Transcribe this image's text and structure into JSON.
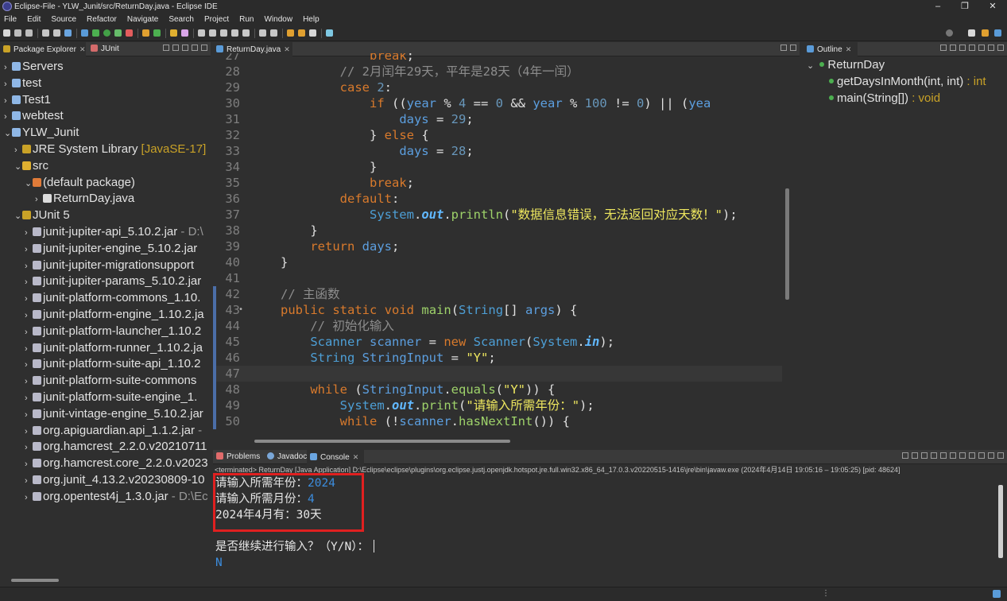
{
  "window": {
    "title": "Eclipse-File - YLW_Junit/src/ReturnDay.java - Eclipse IDE",
    "controls": [
      "–",
      "❐",
      "✕"
    ]
  },
  "menu": [
    "File",
    "Edit",
    "Source",
    "Refactor",
    "Navigate",
    "Search",
    "Project",
    "Run",
    "Window",
    "Help"
  ],
  "package_explorer": {
    "tabs": [
      "Package Explorer",
      "JUnit"
    ],
    "items": [
      {
        "label": "Servers",
        "arrow": "›",
        "icon": "project-icon",
        "indent": 0
      },
      {
        "label": "test",
        "arrow": "›",
        "icon": "project-icon",
        "indent": 0
      },
      {
        "label": "Test1",
        "arrow": "›",
        "icon": "project-icon",
        "indent": 0
      },
      {
        "label": "webtest",
        "arrow": "›",
        "icon": "project-icon",
        "indent": 0
      },
      {
        "label": "YLW_Junit",
        "arrow": "⌄",
        "icon": "project-icon",
        "indent": 0
      },
      {
        "label": "JRE System Library",
        "decoration": "[JavaSE-17]",
        "arrow": "›",
        "icon": "library-icon",
        "indent": 1
      },
      {
        "label": "src",
        "arrow": "⌄",
        "icon": "source-folder-icon",
        "indent": 1
      },
      {
        "label": "(default package)",
        "arrow": "⌄",
        "icon": "package-icon",
        "indent": 2
      },
      {
        "label": "ReturnDay.java",
        "arrow": "›",
        "icon": "java-file-icon",
        "indent": 3
      },
      {
        "label": "JUnit 5",
        "arrow": "⌄",
        "icon": "library-icon",
        "indent": 1
      },
      {
        "label": "junit-jupiter-api_5.10.2.jar",
        "decoration": " - D:\\",
        "arrow": "›",
        "icon": "jar-icon",
        "indent": 2
      },
      {
        "label": "junit-jupiter-engine_5.10.2.jar",
        "arrow": "›",
        "icon": "jar-icon",
        "indent": 2
      },
      {
        "label": "junit-jupiter-migrationsupport",
        "arrow": "›",
        "icon": "jar-icon",
        "indent": 2
      },
      {
        "label": "junit-jupiter-params_5.10.2.jar",
        "arrow": "›",
        "icon": "jar-icon",
        "indent": 2
      },
      {
        "label": "junit-platform-commons_1.10.",
        "arrow": "›",
        "icon": "jar-icon",
        "indent": 2
      },
      {
        "label": "junit-platform-engine_1.10.2.ja",
        "arrow": "›",
        "icon": "jar-icon",
        "indent": 2
      },
      {
        "label": "junit-platform-launcher_1.10.2",
        "arrow": "›",
        "icon": "jar-icon",
        "indent": 2
      },
      {
        "label": "junit-platform-runner_1.10.2.ja",
        "arrow": "›",
        "icon": "jar-icon",
        "indent": 2
      },
      {
        "label": "junit-platform-suite-api_1.10.2",
        "arrow": "›",
        "icon": "jar-icon",
        "indent": 2
      },
      {
        "label": "junit-platform-suite-commons",
        "arrow": "›",
        "icon": "jar-icon",
        "indent": 2
      },
      {
        "label": "junit-platform-suite-engine_1.",
        "arrow": "›",
        "icon": "jar-icon",
        "indent": 2
      },
      {
        "label": "junit-vintage-engine_5.10.2.jar",
        "arrow": "›",
        "icon": "jar-icon",
        "indent": 2
      },
      {
        "label": "org.apiguardian.api_1.1.2.jar",
        "decoration": " -",
        "arrow": "›",
        "icon": "jar-icon",
        "indent": 2
      },
      {
        "label": "org.hamcrest_2.2.0.v20210711",
        "arrow": "›",
        "icon": "jar-icon",
        "indent": 2
      },
      {
        "label": "org.hamcrest.core_2.2.0.v2023",
        "arrow": "›",
        "icon": "jar-icon",
        "indent": 2
      },
      {
        "label": "org.junit_4.13.2.v20230809-10",
        "arrow": "›",
        "icon": "jar-icon",
        "indent": 2
      },
      {
        "label": "org.opentest4j_1.3.0.jar",
        "decoration": " - D:\\Ec",
        "arrow": "›",
        "icon": "jar-icon",
        "indent": 2
      }
    ]
  },
  "editor": {
    "tab": "ReturnDay.java",
    "current_line": 47,
    "lines": [
      {
        "n": "27",
        "t": [
          [
            "            ",
            "p"
          ],
          [
            "break",
            "k"
          ],
          [
            ";",
            "p"
          ]
        ]
      },
      {
        "n": "28",
        "t": [
          [
            "        ",
            "p"
          ],
          [
            "// 2月闰年29天，平年是28天（4年一闰）",
            "c"
          ]
        ]
      },
      {
        "n": "29",
        "t": [
          [
            "        ",
            "p"
          ],
          [
            "case",
            "k"
          ],
          [
            " ",
            "p"
          ],
          [
            "2",
            "n"
          ],
          [
            ":",
            "p"
          ]
        ]
      },
      {
        "n": "30",
        "t": [
          [
            "            ",
            "p"
          ],
          [
            "if",
            "k"
          ],
          [
            " ((",
            "p"
          ],
          [
            "year",
            "v"
          ],
          [
            " % ",
            "p"
          ],
          [
            "4",
            "n"
          ],
          [
            " == ",
            "p"
          ],
          [
            "0",
            "n"
          ],
          [
            " && ",
            "p"
          ],
          [
            "year",
            "v"
          ],
          [
            " % ",
            "p"
          ],
          [
            "100",
            "n"
          ],
          [
            " != ",
            "p"
          ],
          [
            "0",
            "n"
          ],
          [
            ") || (",
            "p"
          ],
          [
            "yea",
            "v"
          ]
        ]
      },
      {
        "n": "31",
        "t": [
          [
            "                ",
            "p"
          ],
          [
            "days",
            "v"
          ],
          [
            " = ",
            "p"
          ],
          [
            "29",
            "n"
          ],
          [
            ";",
            "p"
          ]
        ]
      },
      {
        "n": "32",
        "t": [
          [
            "            } ",
            "p"
          ],
          [
            "else",
            "k"
          ],
          [
            " {",
            "p"
          ]
        ]
      },
      {
        "n": "33",
        "t": [
          [
            "                ",
            "p"
          ],
          [
            "days",
            "v"
          ],
          [
            " = ",
            "p"
          ],
          [
            "28",
            "n"
          ],
          [
            ";",
            "p"
          ]
        ]
      },
      {
        "n": "34",
        "t": [
          [
            "            }",
            "p"
          ]
        ]
      },
      {
        "n": "35",
        "t": [
          [
            "            ",
            "p"
          ],
          [
            "break",
            "k"
          ],
          [
            ";",
            "p"
          ]
        ]
      },
      {
        "n": "36",
        "t": [
          [
            "        ",
            "p"
          ],
          [
            "default",
            "k"
          ],
          [
            ":",
            "p"
          ]
        ]
      },
      {
        "n": "37",
        "t": [
          [
            "            ",
            "p"
          ],
          [
            "System",
            "t"
          ],
          [
            ".",
            "p"
          ],
          [
            "out",
            "st"
          ],
          [
            ".",
            "p"
          ],
          [
            "println",
            "m"
          ],
          [
            "(",
            "p"
          ],
          [
            "\"数据信息错误，无法返回对应天数！\"",
            "s"
          ],
          [
            ");",
            "p"
          ]
        ]
      },
      {
        "n": "38",
        "t": [
          [
            "    }",
            "p"
          ]
        ]
      },
      {
        "n": "39",
        "t": [
          [
            "    ",
            "p"
          ],
          [
            "return",
            "k"
          ],
          [
            " ",
            "p"
          ],
          [
            "days",
            "v"
          ],
          [
            ";",
            "p"
          ]
        ]
      },
      {
        "n": "40",
        "t": [
          [
            "}",
            "p"
          ]
        ]
      },
      {
        "n": "41",
        "t": [
          [
            "",
            "p"
          ]
        ]
      },
      {
        "n": "42",
        "t": [
          [
            "// 主函数",
            "c"
          ]
        ]
      },
      {
        "n": "43",
        "mark": "•",
        "t": [
          [
            "public",
            "k"
          ],
          [
            " ",
            "p"
          ],
          [
            "static",
            "k"
          ],
          [
            " ",
            "p"
          ],
          [
            "void",
            "k"
          ],
          [
            " ",
            "p"
          ],
          [
            "main",
            "m"
          ],
          [
            "(",
            "p"
          ],
          [
            "String",
            "t"
          ],
          [
            "[] ",
            "p"
          ],
          [
            "args",
            "v"
          ],
          [
            ") {",
            "p"
          ]
        ]
      },
      {
        "n": "44",
        "t": [
          [
            "    ",
            "p"
          ],
          [
            "// 初始化输入",
            "c"
          ]
        ]
      },
      {
        "n": "45",
        "t": [
          [
            "    ",
            "p"
          ],
          [
            "Scanner",
            "t"
          ],
          [
            " ",
            "p"
          ],
          [
            "scanner",
            "v"
          ],
          [
            " = ",
            "p"
          ],
          [
            "new",
            "k"
          ],
          [
            " ",
            "p"
          ],
          [
            "Scanner",
            "t"
          ],
          [
            "(",
            "p"
          ],
          [
            "System",
            "t"
          ],
          [
            ".",
            "p"
          ],
          [
            "in",
            "st"
          ],
          [
            ");",
            "p"
          ]
        ]
      },
      {
        "n": "46",
        "t": [
          [
            "    ",
            "p"
          ],
          [
            "String",
            "t"
          ],
          [
            " ",
            "p"
          ],
          [
            "StringInput",
            "v"
          ],
          [
            " = ",
            "p"
          ],
          [
            "\"Y\"",
            "s"
          ],
          [
            ";",
            "p"
          ]
        ]
      },
      {
        "n": "47",
        "t": [
          [
            "",
            "p"
          ]
        ]
      },
      {
        "n": "48",
        "t": [
          [
            "    ",
            "p"
          ],
          [
            "while",
            "k"
          ],
          [
            " (",
            "p"
          ],
          [
            "StringInput",
            "v"
          ],
          [
            ".",
            "p"
          ],
          [
            "equals",
            "m"
          ],
          [
            "(",
            "p"
          ],
          [
            "\"Y\"",
            "s"
          ],
          [
            ")) {",
            "p"
          ]
        ]
      },
      {
        "n": "49",
        "t": [
          [
            "        ",
            "p"
          ],
          [
            "System",
            "t"
          ],
          [
            ".",
            "p"
          ],
          [
            "out",
            "st"
          ],
          [
            ".",
            "p"
          ],
          [
            "print",
            "m"
          ],
          [
            "(",
            "p"
          ],
          [
            "\"请输入所需年份：\"",
            "s"
          ],
          [
            ");",
            "p"
          ]
        ]
      },
      {
        "n": "50",
        "t": [
          [
            "        ",
            "p"
          ],
          [
            "while",
            "k"
          ],
          [
            " (!",
            "p"
          ],
          [
            "scanner",
            "v"
          ],
          [
            ".",
            "p"
          ],
          [
            "hasNextInt",
            "m"
          ],
          [
            "()) {",
            "p"
          ]
        ]
      }
    ]
  },
  "outline": {
    "tab": "Outline",
    "class_name": "ReturnDay",
    "members": [
      {
        "name": "getDaysInMonth(int, int)",
        "ret": " : int"
      },
      {
        "name": "main(String[])",
        "ret": " : void"
      }
    ]
  },
  "console": {
    "tabs": [
      "Problems",
      "Javadoc",
      "Console"
    ],
    "header": "<terminated> ReturnDay [Java Application] D:\\Eclipse\\eclipse\\plugins\\org.eclipse.justj.openjdk.hotspot.jre.full.win32.x86_64_17.0.3.v20220515-1416\\jre\\bin\\javaw.exe  (2024年4月14日 19:05:16 – 19:05:25) [pid: 48624]",
    "lines": [
      {
        "prompt": "请输入所需年份：",
        "input": "2024"
      },
      {
        "prompt": "请输入所需月份：",
        "input": "4"
      },
      {
        "prompt": "2024年4月有：30天",
        "input": ""
      },
      {
        "prompt": "",
        "input": ""
      },
      {
        "prompt": "是否继续进行输入？（Y/N）：",
        "input": ""
      },
      {
        "prompt": "",
        "input": "N"
      }
    ]
  },
  "colors": {
    "background": "#2f2f2f",
    "keyword": "#d97a2c",
    "string": "#eee75f",
    "comment": "#8c8c8c",
    "highlight_box": "#e02020"
  }
}
